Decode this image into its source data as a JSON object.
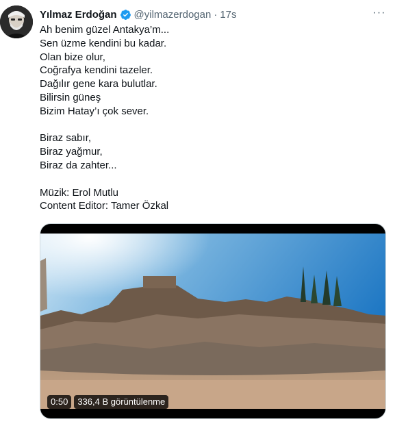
{
  "tweet": {
    "author_name": "Yılmaz Erdoğan",
    "author_handle": "@yilmazerdogan",
    "separator": "·",
    "time": "17s",
    "more_label": "···",
    "text_lines": [
      "Ah benim güzel Antakya’m...",
      "Sen üzme kendini bu kadar.",
      "Olan bize olur,",
      "Coğrafya kendini tazeler.",
      "Dağılır gene kara bulutlar.",
      "Bilirsin güneş",
      "Bizim Hatay’ı çok sever.",
      "",
      "Biraz sabır,",
      "Biraz yağmur,",
      "Biraz da zahter...",
      "",
      "Müzik: Erol Mutlu",
      "Content Editor: Tamer Özkal"
    ]
  },
  "media": {
    "duration": "0:50",
    "views": "336,4 B görüntülenme"
  },
  "colors": {
    "verified": "#1d9bf0",
    "secondary_text": "#536471",
    "primary_text": "#0f1419"
  }
}
